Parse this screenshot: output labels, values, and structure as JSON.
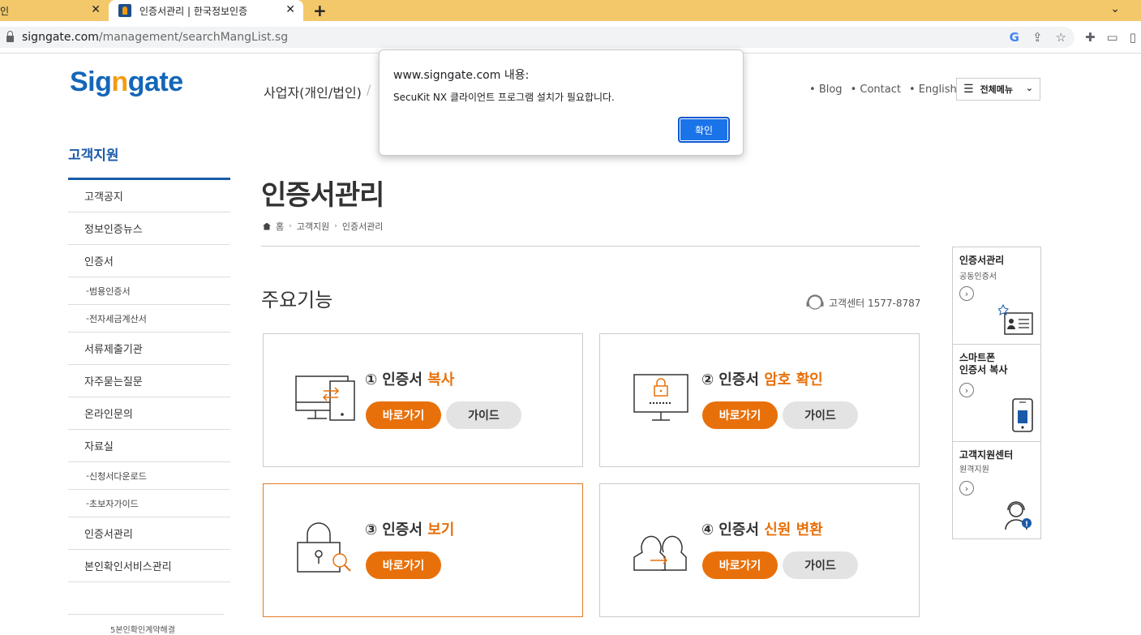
{
  "browser": {
    "tabs": [
      {
        "title": "인",
        "active": false
      },
      {
        "title": "인증서관리 | 한국정보인증",
        "active": true
      }
    ],
    "close_glyph": "✕",
    "newtab_glyph": "+",
    "url_host": "signgate.com",
    "url_path": "/management/searchMangList.sg"
  },
  "header": {
    "logo_pre": "Sig",
    "logo_n": "n",
    "logo_post": "gate",
    "biz_link": "사업자(개인/법인)",
    "top_links": [
      "Blog",
      "Contact",
      "English"
    ],
    "all_menu": "전체메뉴"
  },
  "sidebar": {
    "title": "고객지원",
    "items": [
      {
        "label": "고객공지",
        "type": "item"
      },
      {
        "label": "정보인증뉴스",
        "type": "item"
      },
      {
        "label": "인증서",
        "type": "item"
      },
      {
        "label": "범용인증서",
        "type": "sub"
      },
      {
        "label": "전자세금계산서",
        "type": "sub"
      },
      {
        "label": "서류제출기관",
        "type": "item"
      },
      {
        "label": "자주묻는질문",
        "type": "item"
      },
      {
        "label": "온라인문의",
        "type": "item"
      },
      {
        "label": "자료실",
        "type": "item"
      },
      {
        "label": "신청서다운로드",
        "type": "sub"
      },
      {
        "label": "초보자가이드",
        "type": "sub"
      },
      {
        "label": "인증서관리",
        "type": "item"
      },
      {
        "label": "본인확인서비스관리",
        "type": "item"
      }
    ],
    "cut_text": "5본인확인계약해결"
  },
  "main": {
    "page_title": "인증서관리",
    "breadcrumb": [
      "홈",
      "고객지원",
      "인증서관리"
    ],
    "section_title": "주요기능",
    "helpline": "고객센터 1577-8787",
    "cards": [
      {
        "num": "①",
        "pre": "인증서",
        "accent": "복사",
        "go": "바로가기",
        "guide": "가이드"
      },
      {
        "num": "②",
        "pre": "인증서",
        "accent": "암호 확인",
        "go": "바로가기",
        "guide": "가이드"
      },
      {
        "num": "③",
        "pre": "인증서",
        "accent": "보기",
        "go": "바로가기",
        "guide": ""
      },
      {
        "num": "④",
        "pre": "인증서",
        "accent": "신원 변환",
        "go": "바로가기",
        "guide": "가이드"
      }
    ]
  },
  "quick": [
    {
      "title": "인증서관리",
      "sub": "공동인증서"
    },
    {
      "title": "스마트폰\n인증서 복사",
      "sub": ""
    },
    {
      "title": "고객지원센터",
      "sub": "원격지원"
    }
  ],
  "dialog": {
    "title": "www.signgate.com 내용:",
    "message": "SecuKit NX 클라이언트 프로그램 설치가 필요합니다.",
    "ok": "확인"
  },
  "colors": {
    "brand_blue": "#1466b8",
    "accent_orange": "#e8700a",
    "tab_bar": "#f2c86b"
  }
}
